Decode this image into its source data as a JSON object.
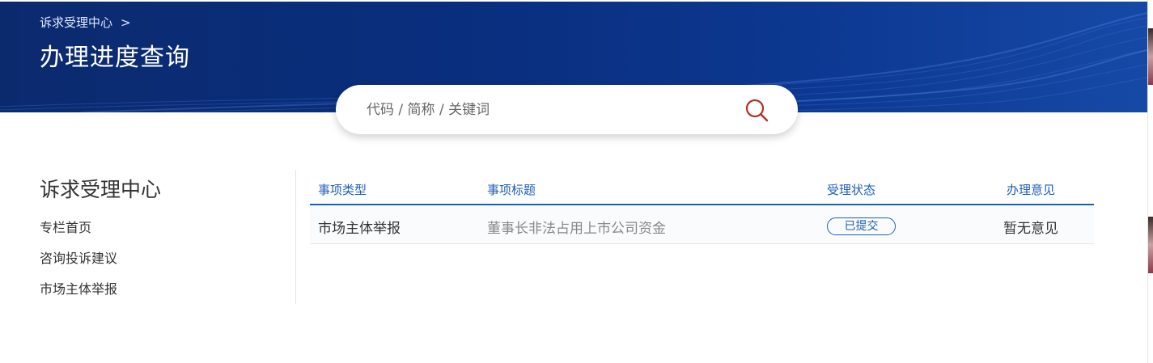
{
  "header": {
    "breadcrumb": "诉求受理中心",
    "breadcrumb_separator": ">",
    "title": "办理进度查询"
  },
  "search": {
    "placeholder": "代码 / 简称 / 关键词",
    "icon": "search-icon"
  },
  "sidebar": {
    "title": "诉求受理中心",
    "items": [
      {
        "label": "专栏首页"
      },
      {
        "label": "咨询投诉建议"
      },
      {
        "label": "市场主体举报"
      }
    ]
  },
  "table": {
    "columns": [
      "事项类型",
      "事项标题",
      "受理状态",
      "办理意见"
    ],
    "rows": [
      {
        "type": "市场主体举报",
        "title": "董事长非法占用上市公司资金",
        "status": "已提交",
        "opinion": "暂无意见"
      }
    ]
  },
  "colors": {
    "banner": "#0b2a6e",
    "accent": "#1c5fb5",
    "search_icon": "#b0302a"
  }
}
